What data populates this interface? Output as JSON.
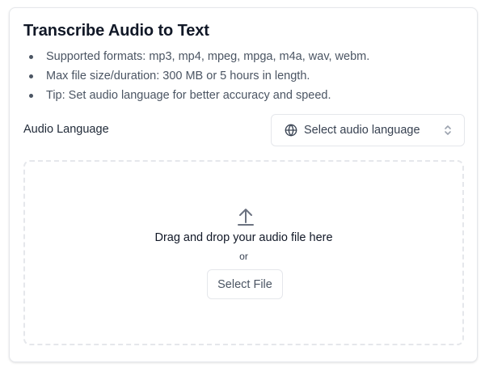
{
  "card": {
    "title": "Transcribe Audio to Text",
    "bullets": [
      "Supported formats: mp3, mp4, mpeg, mpga, m4a, wav, webm.",
      "Max file size/duration: 300 MB or 5 hours in length.",
      "Tip: Set audio language for better accuracy and speed."
    ]
  },
  "language": {
    "label": "Audio Language",
    "select_placeholder": "Select audio language",
    "icon": "globe-icon",
    "chevron_icon": "chevron-up-down-icon"
  },
  "dropzone": {
    "icon": "upload-icon",
    "prompt": "Drag and drop your audio file here",
    "or_text": "or",
    "button_label": "Select File"
  },
  "colors": {
    "border": "#e5e7eb",
    "text_primary": "#111827",
    "text_secondary": "#4b5563"
  }
}
